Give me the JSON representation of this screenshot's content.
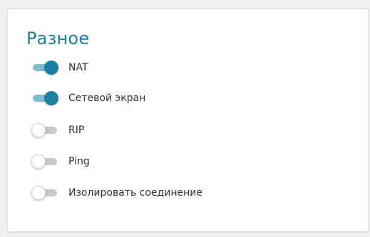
{
  "section": {
    "title": "Разное"
  },
  "toggles": [
    {
      "label": "NAT",
      "state": "on"
    },
    {
      "label": "Сетевой экран",
      "state": "on"
    },
    {
      "label": "RIP",
      "state": "off"
    },
    {
      "label": "Ping",
      "state": "off"
    },
    {
      "label": "Изолировать соединение",
      "state": "off"
    }
  ],
  "colors": {
    "accent": "#1b7fa3",
    "toggle_track_on": "#7fbcd3",
    "toggle_track_off": "#c9c9c9",
    "label_text": "#333333"
  }
}
